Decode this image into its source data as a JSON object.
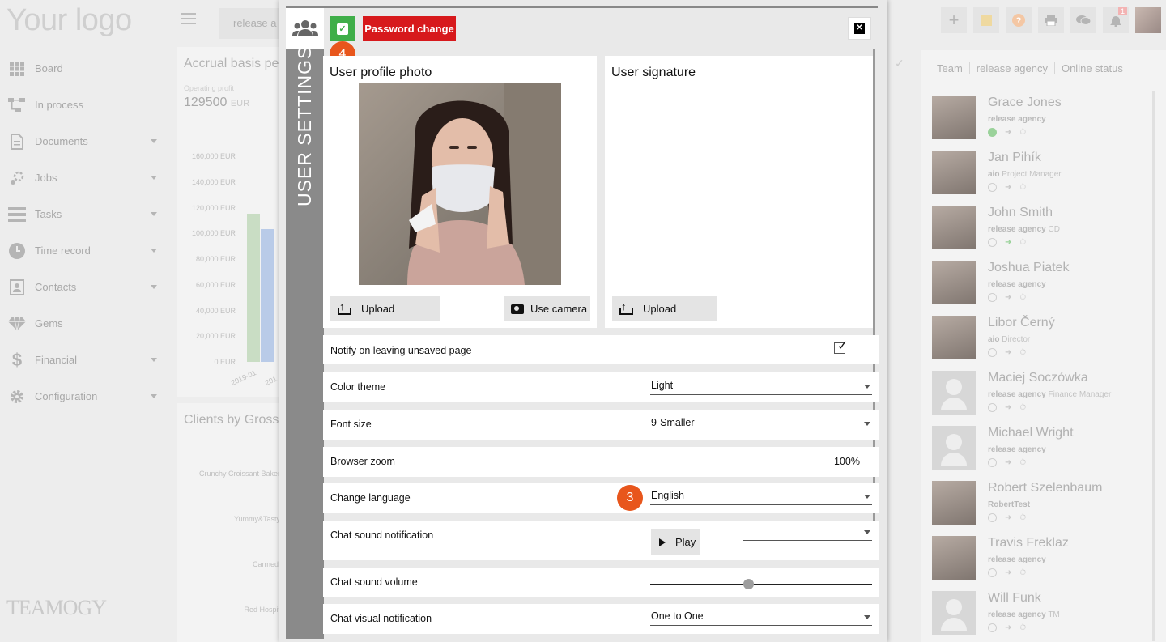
{
  "app": {
    "logo": "Your logo",
    "footer_logo": "TEAMOGY",
    "breadcrumb_top": "release a",
    "notification_count": "1"
  },
  "sidebar": {
    "items": [
      {
        "label": "Board",
        "icon": "grid-icon"
      },
      {
        "label": "In process",
        "icon": "flow-icon"
      },
      {
        "label": "Documents",
        "icon": "document-icon"
      },
      {
        "label": "Jobs",
        "icon": "jobs-icon"
      },
      {
        "label": "Tasks",
        "icon": "tasks-icon"
      },
      {
        "label": "Time record",
        "icon": "clock-icon"
      },
      {
        "label": "Contacts",
        "icon": "contacts-icon"
      },
      {
        "label": "Gems",
        "icon": "gem-icon"
      },
      {
        "label": "Financial",
        "icon": "dollar-icon"
      },
      {
        "label": "Configuration",
        "icon": "gear-icon"
      }
    ]
  },
  "dashboard": {
    "accrual_title": "Accrual basis pe",
    "operating_profit_label": "Operating profit",
    "operating_profit_value": "129500",
    "operating_profit_currency": "EUR",
    "clients_title": "Clients by Gross",
    "client_labels": [
      "Crunchy Croissant Baker",
      "Yummy&Tasty",
      "Carmedi",
      "Red Hospit"
    ]
  },
  "chart_data": {
    "type": "bar",
    "title": "Accrual basis pe",
    "categories": [
      "2019-01",
      "201"
    ],
    "y_ticks": [
      "160,000 EUR",
      "140,000 EUR",
      "120,000 EUR",
      "100,000 EUR",
      "80,000 EUR",
      "60,000 EUR",
      "40,000 EUR",
      "20,000 EUR",
      "0 EUR"
    ],
    "x_ticks": [
      "2019-01",
      "201"
    ],
    "ylim": [
      0,
      160000
    ],
    "series": [
      {
        "values": [
          115000,
          0
        ],
        "color": "#c9ddc4"
      },
      {
        "values": [
          0,
          103000
        ],
        "color": "#b9cbe8"
      }
    ]
  },
  "team_panel": {
    "breadcrumb": [
      "Team",
      "release agency",
      "Online status"
    ],
    "members": [
      {
        "name": "Grace Jones",
        "org": "release agency",
        "role": "",
        "online": true,
        "photo": true
      },
      {
        "name": "Jan Pihík",
        "org": "aio",
        "role": "Project Manager",
        "online": false,
        "photo": true
      },
      {
        "name": "John Smith",
        "org": "release agency",
        "role": "CD",
        "online": false,
        "photo": true
      },
      {
        "name": "Joshua Piatek",
        "org": "release agency",
        "role": "",
        "online": false,
        "photo": true
      },
      {
        "name": "Libor Černý",
        "org": "aio",
        "role": "Director",
        "online": false,
        "photo": true
      },
      {
        "name": "Maciej Soczówka",
        "org": "release agency",
        "role": "Finance Manager",
        "online": false,
        "photo": false
      },
      {
        "name": "Michael Wright",
        "org": "release agency",
        "role": "",
        "online": false,
        "photo": false
      },
      {
        "name": "Robert Szelenbaum",
        "org": "RobertTest",
        "role": "",
        "online": false,
        "photo": true
      },
      {
        "name": "Travis Freklaz",
        "org": "release agency",
        "role": "",
        "online": false,
        "photo": true
      },
      {
        "name": "Will Funk",
        "org": "release agency",
        "role": "TM",
        "online": false,
        "photo": false
      }
    ]
  },
  "modal": {
    "vertical_title": "USER SETTINGS",
    "password_button": "Password change",
    "step_badge_top": "4",
    "step_badge_language": "3",
    "profile_photo_title": "User profile photo",
    "signature_title": "User signature",
    "upload_label": "Upload",
    "camera_label": "Use camera",
    "settings": {
      "notify_label": "Notify on leaving unsaved page",
      "notify_checked": true,
      "color_theme_label": "Color theme",
      "color_theme_value": "Light",
      "font_size_label": "Font size",
      "font_size_value": "9-Smaller",
      "browser_zoom_label": "Browser zoom",
      "browser_zoom_value": "100%",
      "language_label": "Change language",
      "language_value": "English",
      "chat_sound_label": "Chat sound notification",
      "play_label": "Play",
      "chat_volume_label": "Chat sound volume",
      "chat_volume_level": 0.44,
      "chat_visual_label": "Chat visual notification",
      "chat_visual_value": "One to One"
    }
  }
}
